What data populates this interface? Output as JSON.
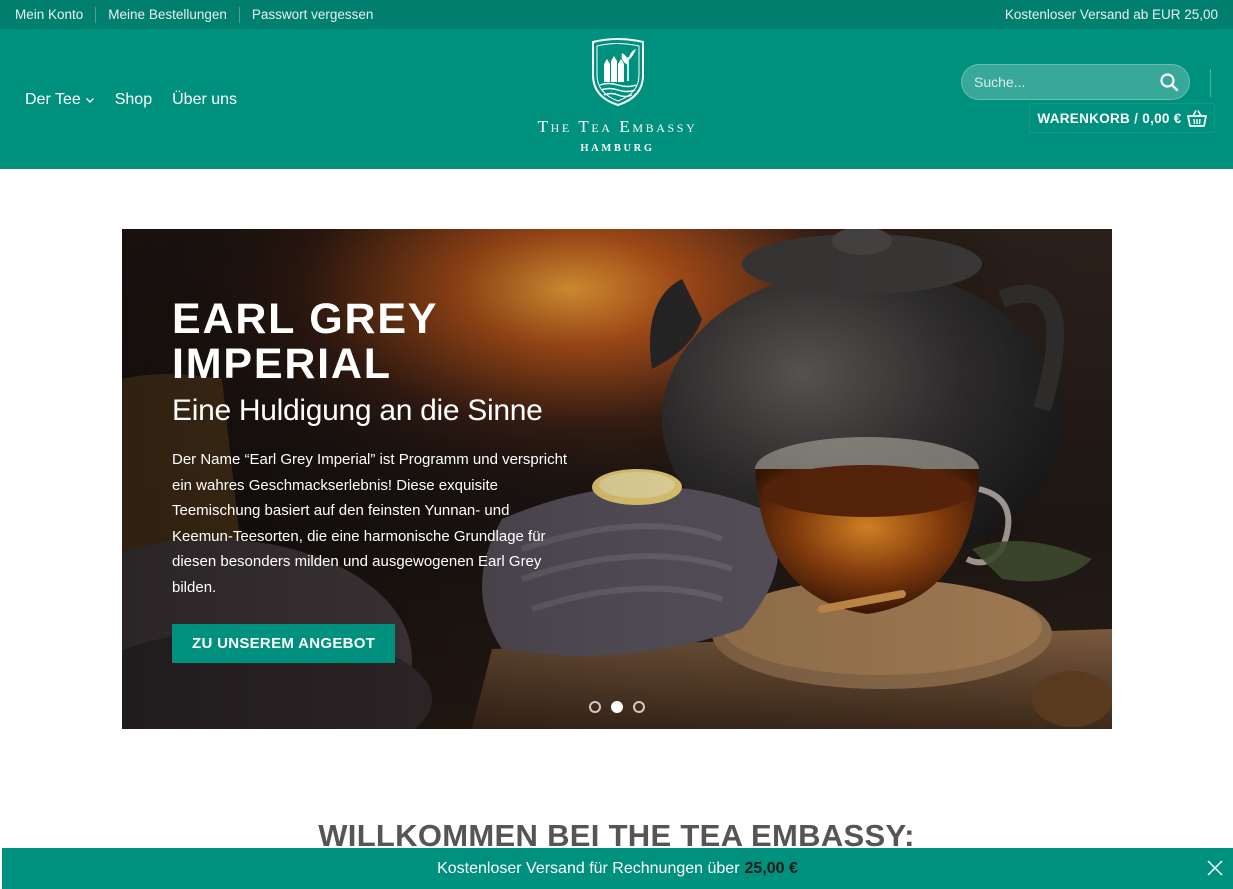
{
  "topbar": {
    "links": [
      "Mein Konto",
      "Meine Bestellungen",
      "Passwort vergessen"
    ],
    "shipping": "Kostenloser Versand ab EUR 25,00"
  },
  "header": {
    "nav": [
      {
        "label": "Der Tee",
        "icon": "chevron-down-icon"
      },
      {
        "label": "Shop"
      },
      {
        "label": "Über uns"
      }
    ],
    "logo": {
      "name": "The Tea Embassy",
      "city": "HAMBURG"
    },
    "search": {
      "placeholder": "Suche..."
    },
    "cart": {
      "label": "WARENKORB / 0,00 €",
      "icon": "basket-icon"
    }
  },
  "hero": {
    "title_line1": "EARL GREY",
    "title_line2": "IMPERIAL",
    "subtitle": "Eine Huldigung an die Sinne",
    "text": "Der Name “Earl Grey Imperial” ist Programm und verspricht ein wahres Geschmackserlebnis! Diese exquisite Teemischung basiert auf den feinsten Yunnan- und Keemun-Teesorten, die eine harmonische Grundlage für diesen besonders milden und ausgewogenen Earl Grey bilden.",
    "cta": "ZU UNSEREM ANGEBOT",
    "slides": 3,
    "active_slide": 2
  },
  "welcome": "WILLKOMMEN BEI THE TEA EMBASSY:",
  "notice": {
    "text": "Kostenloser Versand für Rechnungen über",
    "amount": "25,00 €"
  },
  "colors": {
    "brand": "#00907e",
    "topbar": "#007e6e",
    "heading": "#555555"
  }
}
